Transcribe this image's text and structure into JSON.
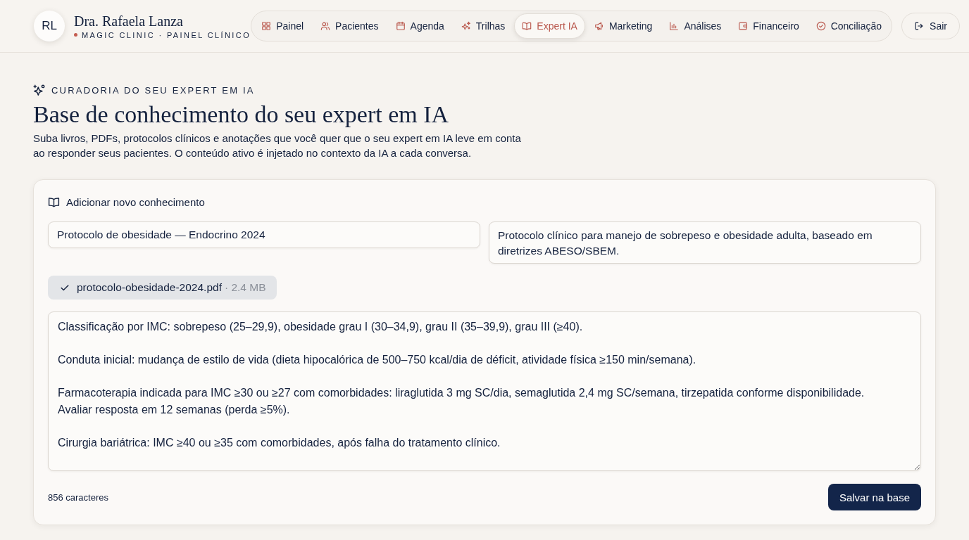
{
  "header": {
    "avatar_initials": "RL",
    "name": "Dra. Rafaela Lanza",
    "subtitle": "MAGIC CLINIC · PAINEL CLÍNICO"
  },
  "nav": {
    "items": [
      {
        "label": "Painel",
        "selected": false
      },
      {
        "label": "Pacientes",
        "selected": false
      },
      {
        "label": "Agenda",
        "selected": false
      },
      {
        "label": "Trilhas",
        "selected": false
      },
      {
        "label": "Expert IA",
        "selected": true
      },
      {
        "label": "Marketing",
        "selected": false
      },
      {
        "label": "Análises",
        "selected": false
      },
      {
        "label": "Financeiro",
        "selected": false
      },
      {
        "label": "Conciliação",
        "selected": false
      }
    ],
    "logout": {
      "label": "Sair"
    }
  },
  "intro": {
    "eyebrow": "CURADORIA DO SEU EXPERT EM IA",
    "title": "Base de conhecimento do seu expert em IA",
    "description": "Suba livros, PDFs, protocolos clínicos e anotações que você quer que o seu expert em IA leve em conta ao responder seus pacientes. O conteúdo ativo é injetado no contexto da IA a cada conversa."
  },
  "form": {
    "heading": "Adicionar novo conhecimento",
    "title_field": {
      "value": "Protocolo de obesidade — Endocrino 2024"
    },
    "description_field": {
      "value": "Protocolo clínico para manejo de sobrepeso e obesidade adulta, baseado em diretrizes ABESO/SBEM."
    },
    "file": {
      "name": "protocolo-obesidade-2024.pdf",
      "size": "· 2.4 MB"
    },
    "content_field": {
      "value": "Classificação por IMC: sobrepeso (25–29,9), obesidade grau I (30–34,9), grau II (35–39,9), grau III (≥40).\n\nConduta inicial: mudança de estilo de vida (dieta hipocalórica de 500–750 kcal/dia de déficit, atividade física ≥150 min/semana).\n\nFarmacoterapia indicada para IMC ≥30 ou ≥27 com comorbidades: liraglutida 3 mg SC/dia, semaglutida 2,4 mg SC/semana, tirzepatida conforme disponibilidade.\nAvaliar resposta em 12 semanas (perda ≥5%).\n\nCirurgia bariátrica: IMC ≥40 ou ≥35 com comorbidades, após falha do tratamento clínico."
    },
    "char_count": "856 caracteres",
    "save_button": "Salvar na base"
  }
}
